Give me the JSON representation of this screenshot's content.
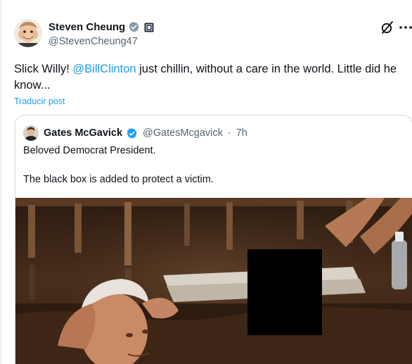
{
  "post": {
    "author": {
      "display_name": "Steven Cheung",
      "handle": "@StevenCheung47"
    },
    "text_before": "Slick Willy! ",
    "mention": "@BillClinton",
    "text_after": " just chillin, without a care in the world. Little did he know...",
    "translate_label": "Traducir post"
  },
  "quote": {
    "author": {
      "display_name": "Gates McGavick",
      "handle": "@GatesMcgavick",
      "separator": "·",
      "time": "7h"
    },
    "line1": "Beloved Democrat President.",
    "line2": "The black box is added to protect a victim."
  },
  "icons": {
    "verified": "verified-badge-icon",
    "affiliation": "affiliation-badge-icon",
    "grok": "grok-icon",
    "more": "more-options-icon"
  },
  "colors": {
    "accent": "#1d9bf0",
    "text": "#0f1419",
    "muted": "#536471",
    "border": "#cfd9de"
  }
}
